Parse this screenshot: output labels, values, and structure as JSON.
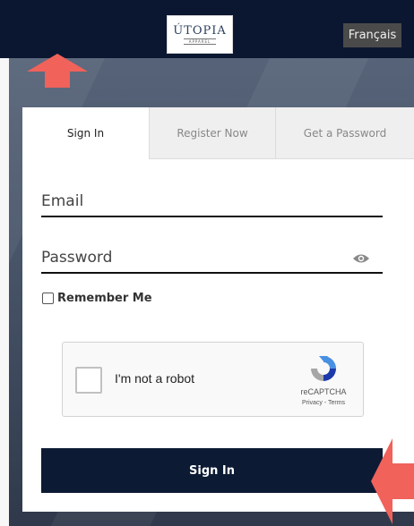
{
  "header": {
    "logo": {
      "text": "ÚTOPIA",
      "subtext": "APPAREL"
    },
    "language_button": "Français",
    "background_color": "#0b1730"
  },
  "tabs": [
    {
      "label": "Sign In",
      "active": true
    },
    {
      "label": "Register Now",
      "active": false
    },
    {
      "label": "Get a Password",
      "active": false
    }
  ],
  "form": {
    "email_label": "Email",
    "email_value": "",
    "password_label": "Password",
    "password_value": "",
    "show_password_icon": "eye-icon",
    "remember_label": "Remember Me",
    "remember_checked": false
  },
  "captcha": {
    "label": "I'm not a robot",
    "brand": "reCAPTCHA",
    "privacy": "Privacy",
    "separator": " - ",
    "terms": "Terms",
    "checked": false
  },
  "submit": {
    "label": "Sign In",
    "color": "#0c1a33"
  },
  "annotations": {
    "arrow_color": "#f0625a"
  }
}
